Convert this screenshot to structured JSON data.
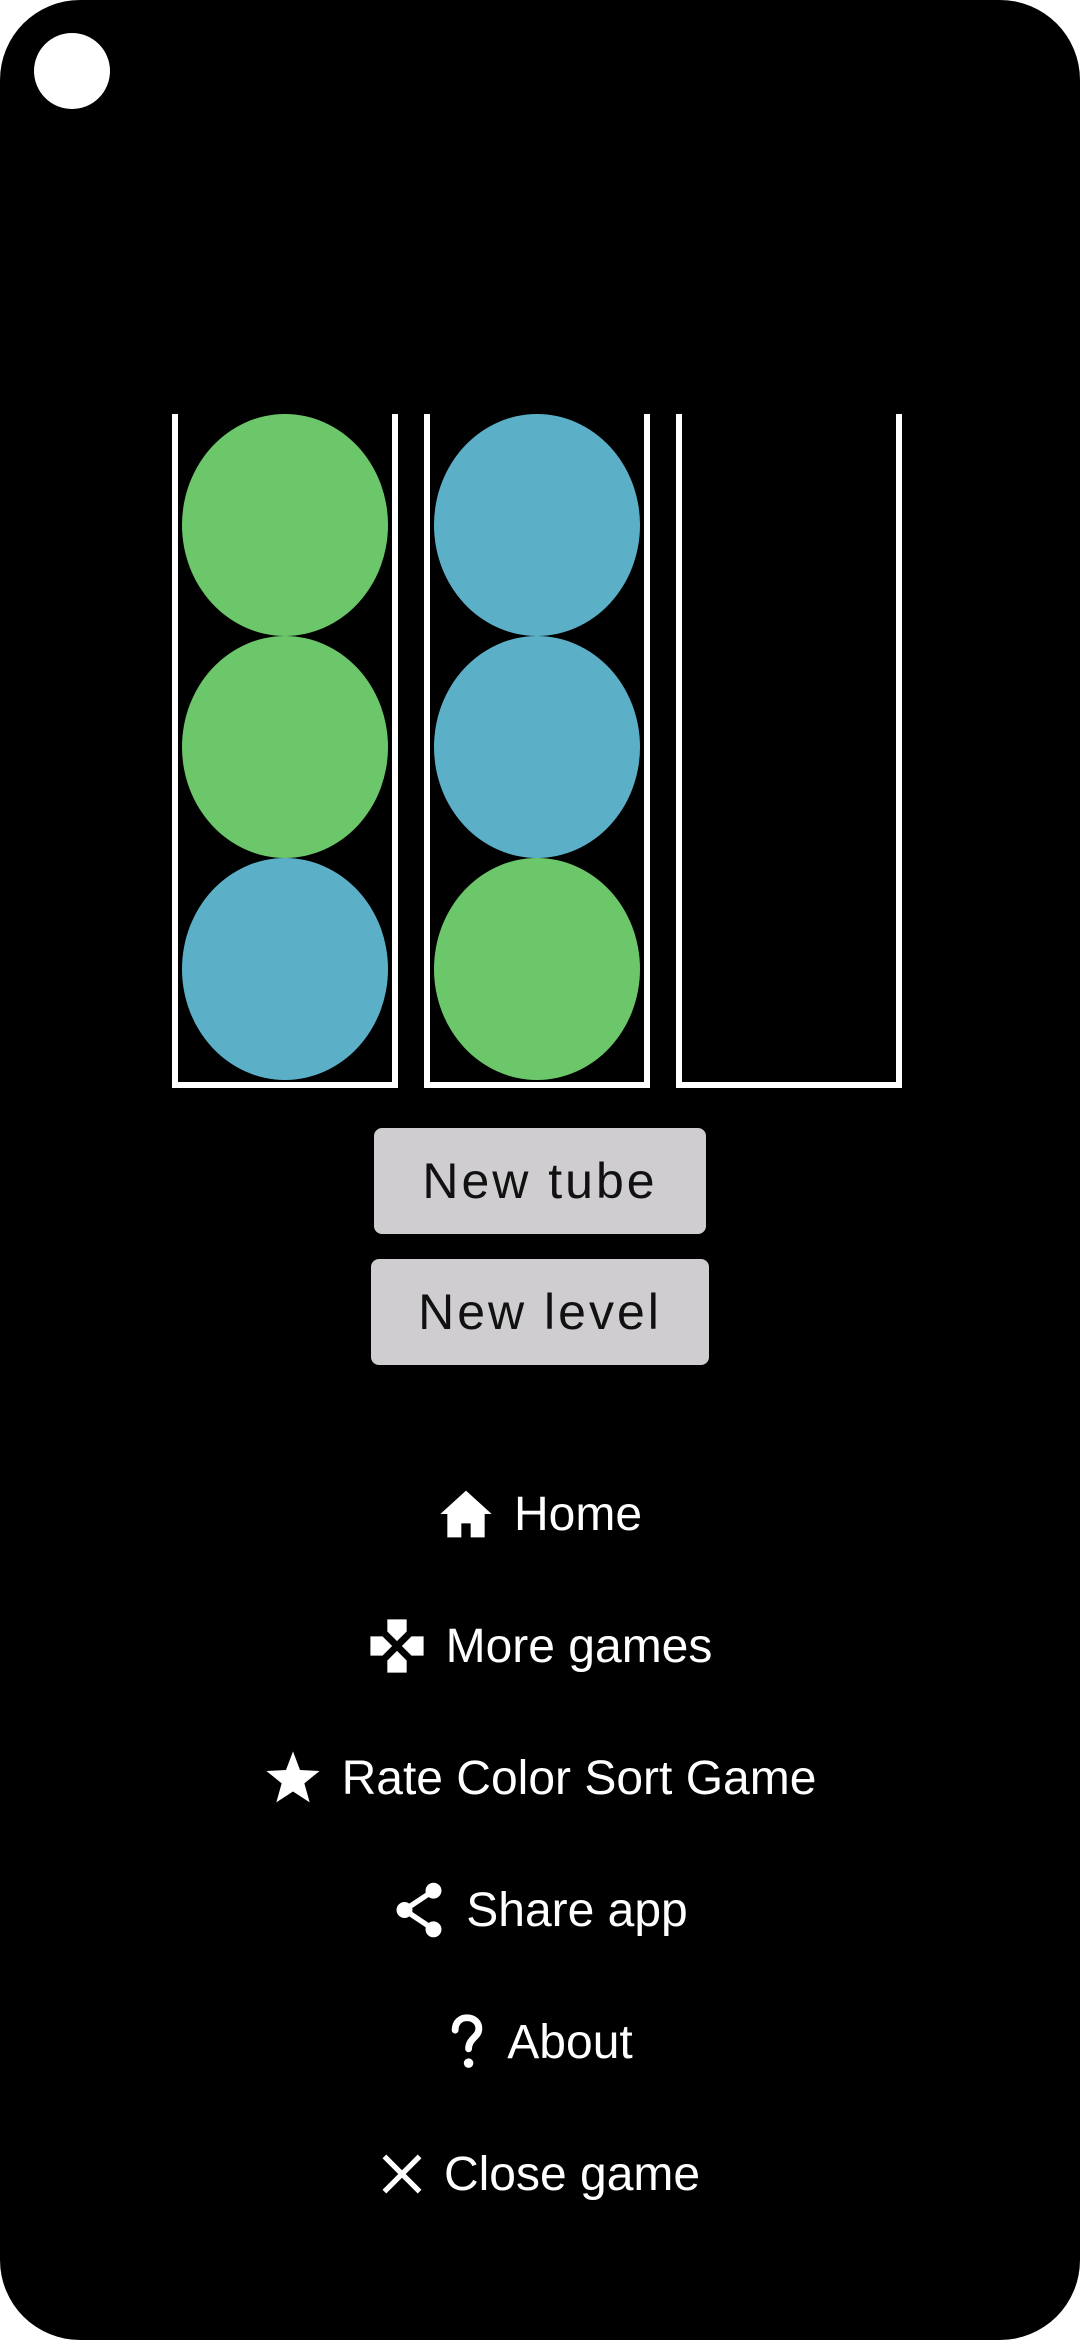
{
  "game": {
    "ball_colors": {
      "green": "#6cc76a",
      "blue": "#5bb0c8"
    },
    "tubes": [
      {
        "balls": [
          "green",
          "green",
          "blue"
        ]
      },
      {
        "balls": [
          "blue",
          "blue",
          "green"
        ]
      },
      {
        "balls": []
      }
    ]
  },
  "buttons": {
    "new_tube": "New tube",
    "new_level": "New level"
  },
  "menu": {
    "home": {
      "label": "Home",
      "icon": "home-icon"
    },
    "more_games": {
      "label": "More games",
      "icon": "gamepad-icon"
    },
    "rate": {
      "label": "Rate Color Sort Game",
      "icon": "star-icon"
    },
    "share": {
      "label": "Share app",
      "icon": "share-icon"
    },
    "about": {
      "label": "About",
      "icon": "question-icon"
    },
    "close": {
      "label": "Close game",
      "icon": "close-icon"
    }
  }
}
